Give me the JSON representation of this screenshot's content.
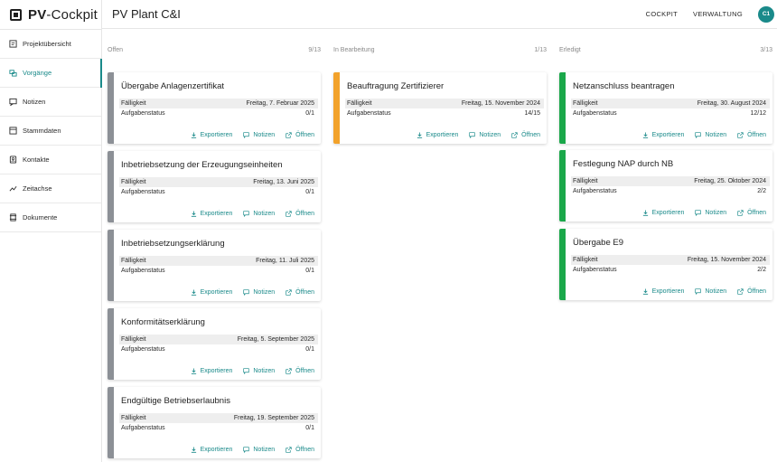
{
  "app": {
    "logo_bold": "PV",
    "logo_rest": "-Cockpit",
    "page_title": "PV Plant C&I"
  },
  "header": {
    "cockpit_label": "COCKPIT",
    "verwaltung_label": "VERWALTUNG",
    "avatar_initials": "C1"
  },
  "sidebar": {
    "items": [
      {
        "label": "Projektübersicht",
        "icon": "project-overview-icon"
      },
      {
        "label": "Vorgänge",
        "icon": "processes-icon",
        "active": true
      },
      {
        "label": "Notizen",
        "icon": "notes-icon"
      },
      {
        "label": "Stammdaten",
        "icon": "master-data-icon"
      },
      {
        "label": "Kontakte",
        "icon": "contacts-icon"
      },
      {
        "label": "Zeitachse",
        "icon": "timeline-icon"
      },
      {
        "label": "Dokumente",
        "icon": "documents-icon"
      }
    ]
  },
  "labels": {
    "due": "Fälligkeit",
    "task_status": "Aufgabenstatus",
    "export": "Exportieren",
    "notes": "Notizen",
    "open": "Öffnen"
  },
  "colors": {
    "accent": "#1a8a8a",
    "open": "#8c9096",
    "in_progress": "#f2a22b",
    "done": "#1aa84a"
  },
  "columns": [
    {
      "title": "Offen",
      "count": "9/13",
      "cards": [
        {
          "title": "Übergabe Anlagenzertifikat",
          "due": "Freitag, 7. Februar 2025",
          "status": "0/1"
        },
        {
          "title": "Inbetriebsetzung der Erzeugungseinheiten",
          "due": "Freitag, 13. Juni 2025",
          "status": "0/1"
        },
        {
          "title": "Inbetriebsetzungserklärung",
          "due": "Freitag, 11. Juli 2025",
          "status": "0/1"
        },
        {
          "title": "Konformitätserklärung",
          "due": "Freitag, 5. September 2025",
          "status": "0/1"
        },
        {
          "title": "Endgültige Betriebserlaubnis",
          "due": "Freitag, 19. September 2025",
          "status": "0/1"
        }
      ]
    },
    {
      "title": "In Bearbeitung",
      "count": "1/13",
      "cards": [
        {
          "title": "Beauftragung Zertifizierer",
          "due": "Freitag, 15. November 2024",
          "status": "14/15"
        }
      ]
    },
    {
      "title": "Erledigt",
      "count": "3/13",
      "cards": [
        {
          "title": "Netzanschluss beantragen",
          "due": "Freitag, 30. August 2024",
          "status": "12/12"
        },
        {
          "title": "Festlegung NAP durch NB",
          "due": "Freitag, 25. Oktober 2024",
          "status": "2/2"
        },
        {
          "title": "Übergabe E9",
          "due": "Freitag, 15. November 2024",
          "status": "2/2"
        }
      ]
    }
  ]
}
